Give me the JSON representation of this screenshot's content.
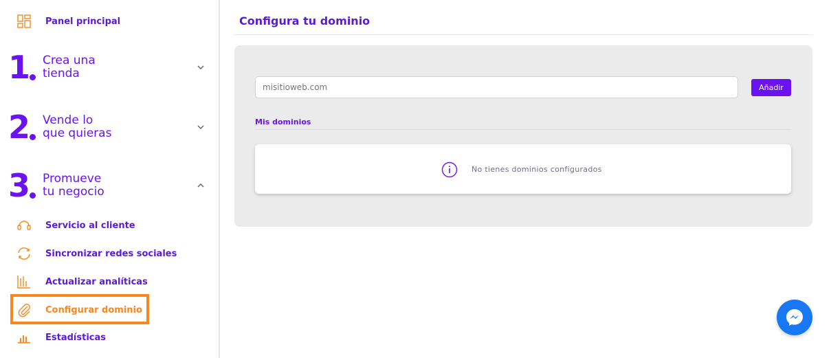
{
  "sidebar": {
    "dashboard": {
      "label": "Panel principal",
      "icon": "dashboard-icon"
    },
    "steps": [
      {
        "number": "1",
        "line1": "Crea una",
        "line2": "tienda",
        "expanded": false
      },
      {
        "number": "2",
        "line1": "Vende lo",
        "line2": "que quieras",
        "expanded": false
      },
      {
        "number": "3",
        "line1": "Promueve",
        "line2": "tu negocio",
        "expanded": true
      }
    ],
    "items": [
      {
        "label": "Servicio al cliente",
        "icon": "headset-icon"
      },
      {
        "label": "Sincronizar redes sociales",
        "icon": "sync-icon"
      },
      {
        "label": "Actualizar analíticas",
        "icon": "analytics-icon"
      },
      {
        "label": "Configurar dominio",
        "icon": "paperclip-icon",
        "active": true
      },
      {
        "label": "Estadísticas",
        "icon": "bar-chart-icon"
      }
    ]
  },
  "main": {
    "title": "Configura tu dominio",
    "domain_input": {
      "placeholder": "misitioweb.com",
      "value": ""
    },
    "add_button": "Añadir",
    "section_label": "Mis dominios",
    "empty_message": "No tienes dominios configurados"
  },
  "colors": {
    "accent": "#6b12f0",
    "accent_dark": "#5a1ad8",
    "orange": "#f6881f",
    "messenger": "#1877f2"
  }
}
